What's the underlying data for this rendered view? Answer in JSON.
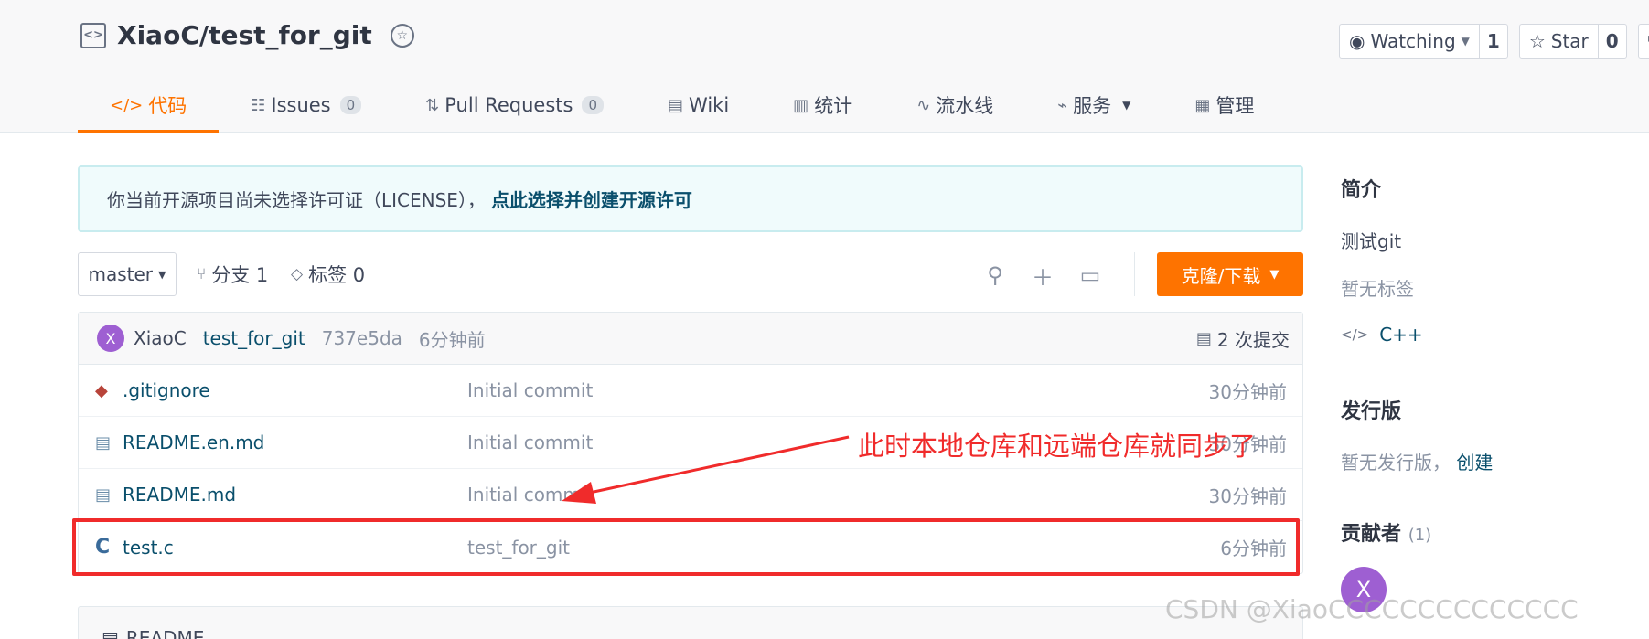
{
  "repo": {
    "title": "XiaoC/test_for_git",
    "icon": "repo-code-icon",
    "badge_icon": "verified-badge-icon"
  },
  "actions": {
    "watch_label": "Watching",
    "watch_count": "1",
    "star_label": "Star",
    "star_count": "0",
    "fork_icon": "fork-icon"
  },
  "tabs": [
    {
      "label": "代码",
      "icon": "code-icon",
      "active": true
    },
    {
      "label": "Issues",
      "icon": "issues-icon",
      "count": "0"
    },
    {
      "label": "Pull Requests",
      "icon": "pull-request-icon",
      "count": "0"
    },
    {
      "label": "Wiki",
      "icon": "wiki-icon"
    },
    {
      "label": "统计",
      "icon": "chart-icon"
    },
    {
      "label": "流水线",
      "icon": "pipeline-icon"
    },
    {
      "label": "服务",
      "icon": "service-icon"
    },
    {
      "label": "管理",
      "icon": "manage-icon"
    }
  ],
  "license_notice": {
    "text": "你当前开源项目尚未选择许可证（LICENSE），",
    "link": "点此选择并创建开源许可"
  },
  "toolbar": {
    "branch": "master",
    "branches_label": "分支 1",
    "tags_label": "标签 0",
    "clone_label": "克隆/下载"
  },
  "last_commit": {
    "avatar_letter": "X",
    "author": "XiaoC",
    "message": "test_for_git",
    "sha": "737e5da",
    "time": "6分钟前",
    "commits_label": "2 次提交"
  },
  "files": [
    {
      "name": ".gitignore",
      "icon": "git-file-icon",
      "message": "Initial commit",
      "time": "30分钟前"
    },
    {
      "name": "README.en.md",
      "icon": "readme-book-icon",
      "message": "Initial commit",
      "time": "30分钟前"
    },
    {
      "name": "README.md",
      "icon": "readme-book-icon",
      "message": "Initial commit",
      "time": "30分钟前"
    },
    {
      "name": "test.c",
      "icon": "c-file-icon",
      "message": "test_for_git",
      "time": "6分钟前"
    }
  ],
  "readme": {
    "label": "README"
  },
  "sidebar": {
    "intro_heading": "简介",
    "description": "测试git",
    "no_tags": "暂无标签",
    "language": "C++",
    "releases_heading": "发行版",
    "no_release": "暂无发行版，",
    "create_link": "创建",
    "contributors_heading": "贡献者",
    "contributors_count": "(1)",
    "contributor_letter": "X"
  },
  "annotation": {
    "text": "此时本地仓库和远端仓库就同步了",
    "color": "#f02b2b"
  },
  "watermark": "CSDN @XiaoCCCCCCCCCCCCCC",
  "colors": {
    "accent": "#fe7300",
    "link": "#0a4f6c",
    "avatar": "#9e5fd2"
  }
}
